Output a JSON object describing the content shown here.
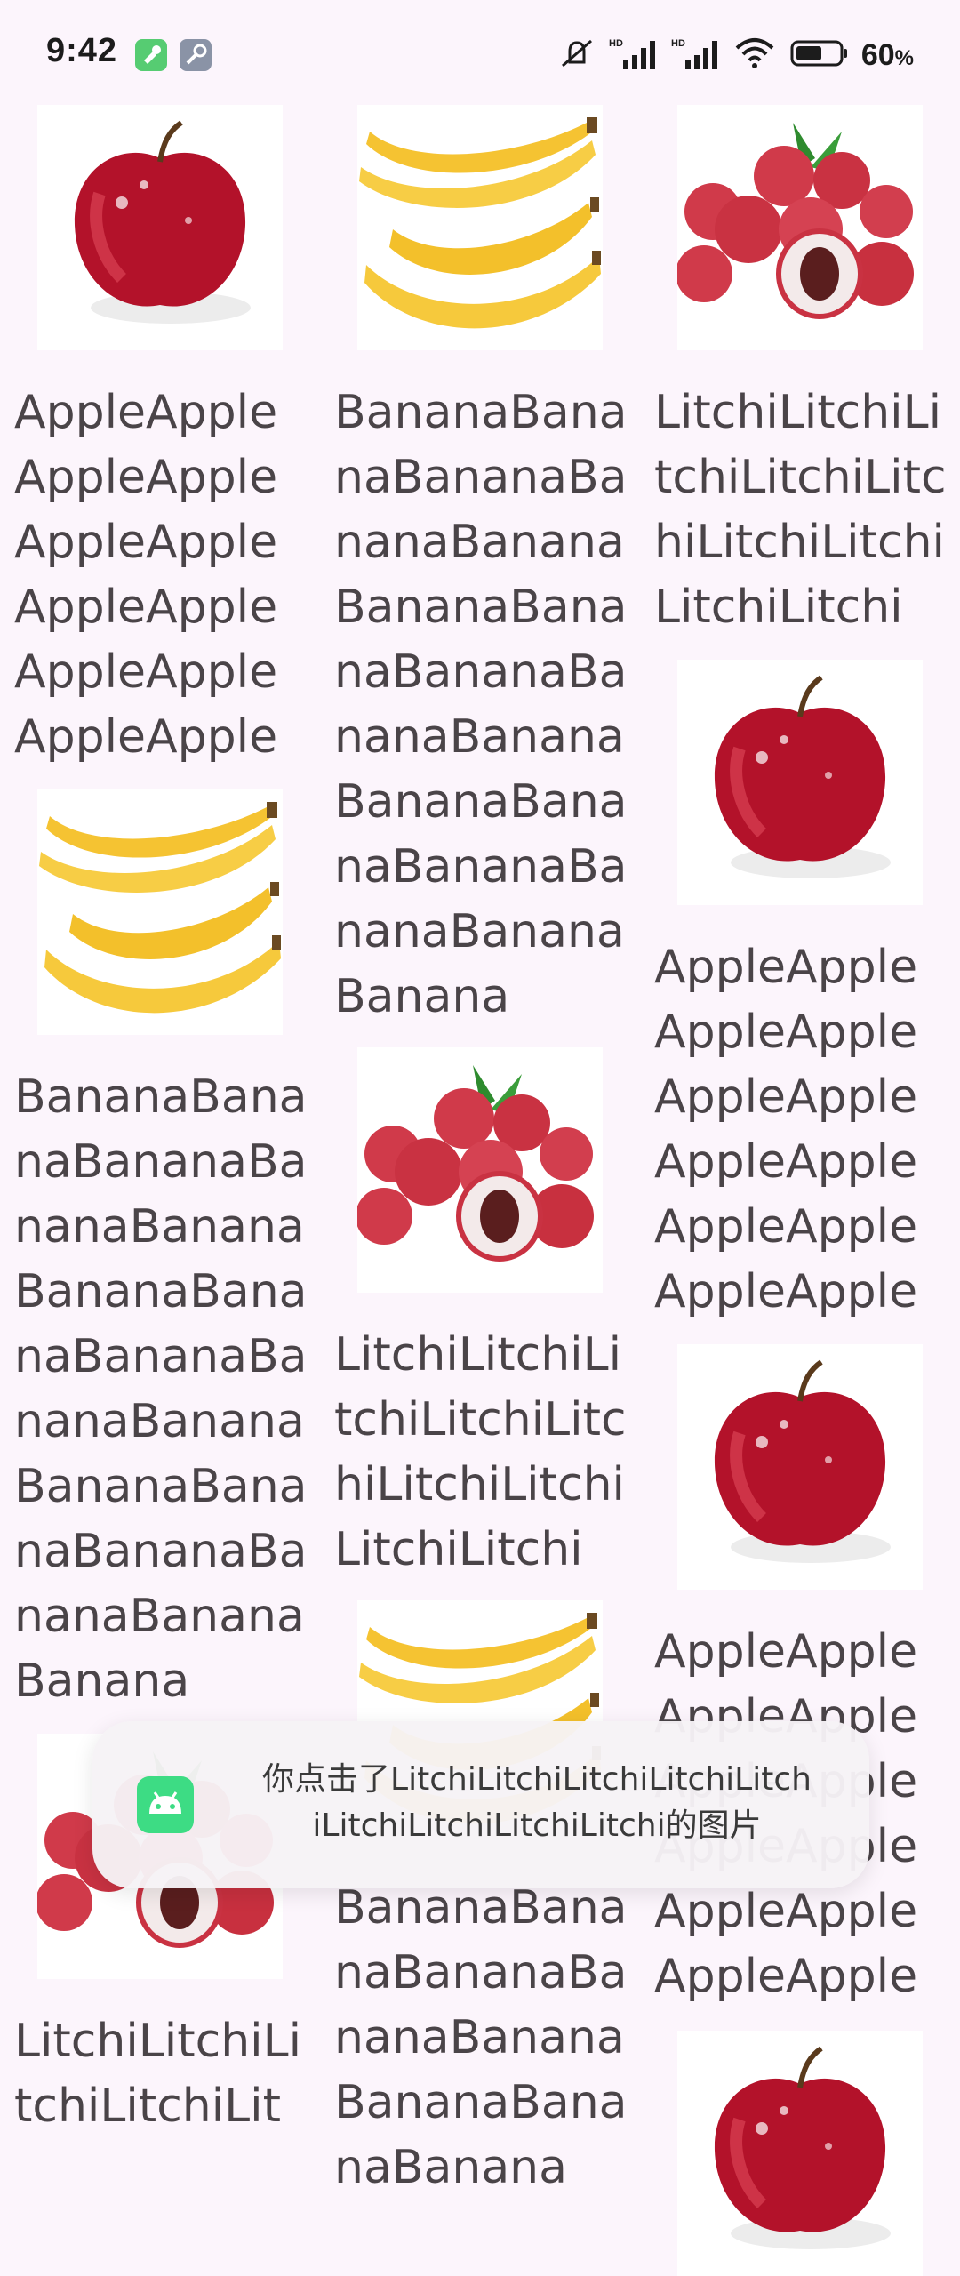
{
  "status_bar": {
    "time": "9:42",
    "battery_percent": "60",
    "battery_unit": "%",
    "icons": [
      "notification-app-icon",
      "tool-app-icon",
      "mute-icon",
      "hd-signal-icon",
      "hd-signal-icon",
      "wifi-icon",
      "battery-icon"
    ]
  },
  "grid": {
    "items": [
      {
        "fruit": "apple",
        "caption": "AppleAppleAppleAppleAppleAppleAppleAppleAppleAppleAppleApple"
      },
      {
        "fruit": "banana",
        "caption": "BananaBananaBananaBananaBananaBananaBananaBananaBananaBananaBananaBananaBananaBananaBananaBanana"
      },
      {
        "fruit": "litchi",
        "caption": "LitchiLitchiLitchiLitchiLitchiLitchiLitchiLitchiLitchi"
      },
      {
        "fruit": "banana",
        "caption": "BananaBananaBananaBananaBananaBananaBananaBananaBananaBananaBananaBananaBananaBananaBananaBanana"
      },
      {
        "fruit": "litchi",
        "caption": "LitchiLitchiLitchiLitchiLitchiLitchiLitchiLitchiLitchi"
      },
      {
        "fruit": "apple",
        "caption": "AppleAppleAppleAppleAppleAppleAppleAppleAppleAppleAppleApple"
      },
      {
        "fruit": "apple",
        "caption": "AppleAppleAppleAppleAppleAppleAppleAppleAppleAppleAppleApple"
      },
      {
        "fruit": "banana",
        "caption": "BananaBananaBananaBananaBananaBananaBananaBanana"
      },
      {
        "fruit": "litchi",
        "caption": "LitchiLitchiLitchiLitchiLit"
      },
      {
        "fruit": "apple",
        "caption": ""
      }
    ]
  },
  "toast": {
    "message": "你点击了LitchiLitchiLitchiLitchiLitchiLitchiLitchiLitchiLitchi的图片",
    "icon": "android-icon"
  },
  "colors": {
    "background": "#fcf5fc",
    "caption_text": "#4a4448",
    "toast_bg": "#f6f2f6",
    "android_green": "#3ddc84"
  }
}
